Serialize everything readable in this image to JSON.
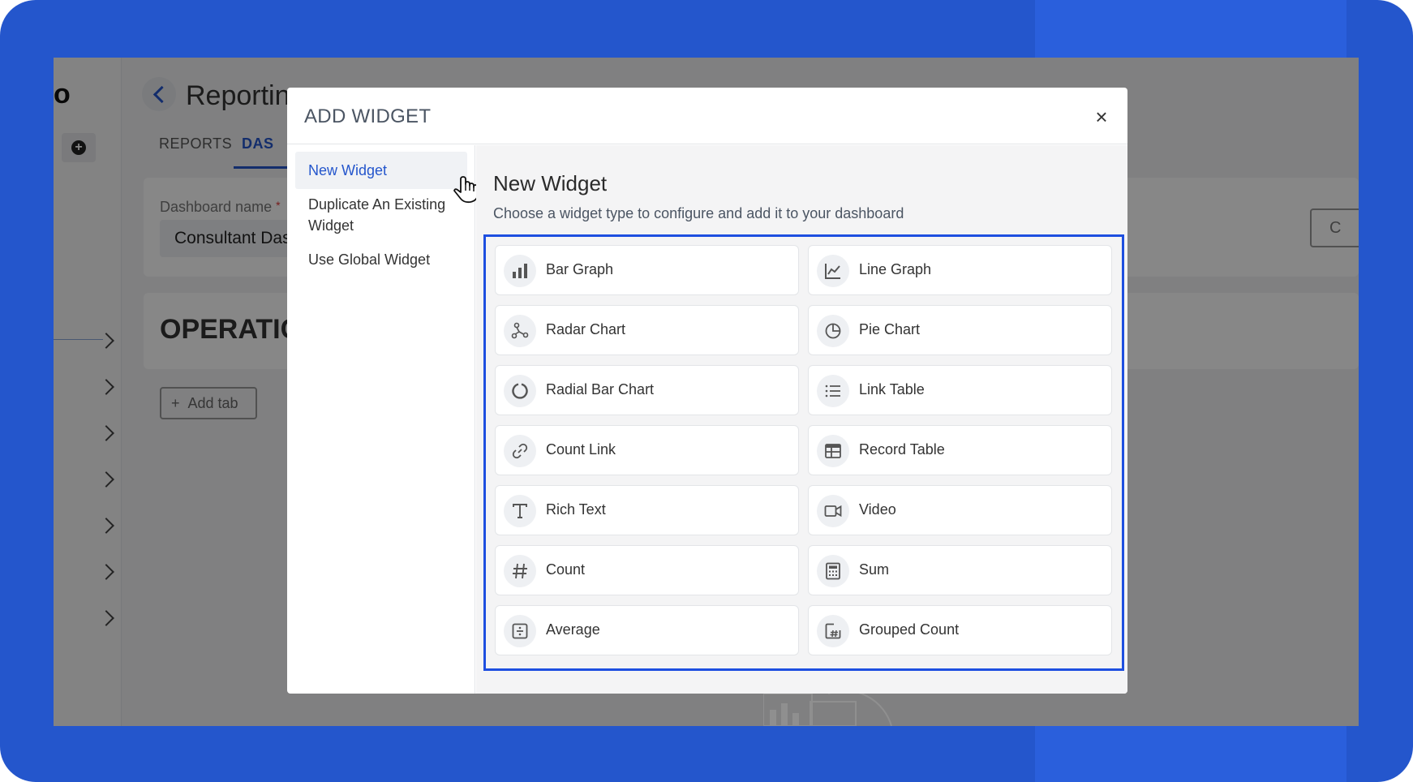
{
  "app": {
    "logo": "o",
    "page_title": "Reportin",
    "tabs": [
      "REPORTS",
      "DAS"
    ],
    "dashboard_label": "Dashboard name",
    "dashboard_required": "*",
    "dashboard_value": "Consultant Das",
    "section_title": "OPERATIC",
    "add_tab_label": "Add tab",
    "refresh_glyph": "C"
  },
  "modal": {
    "title": "ADD WIDGET",
    "close_glyph": "×",
    "nav": {
      "new_widget": "New Widget",
      "duplicate": "Duplicate An Existing Widget",
      "global": "Use Global Widget"
    },
    "content_title": "New Widget",
    "content_subtitle": "Choose a widget type to configure and add it to your dashboard",
    "widgets": [
      {
        "label": "Bar Graph",
        "icon": "bar-graph-icon"
      },
      {
        "label": "Line Graph",
        "icon": "line-graph-icon"
      },
      {
        "label": "Radar Chart",
        "icon": "radar-chart-icon"
      },
      {
        "label": "Pie Chart",
        "icon": "pie-chart-icon"
      },
      {
        "label": "Radial Bar Chart",
        "icon": "radial-bar-icon"
      },
      {
        "label": "Link Table",
        "icon": "list-icon"
      },
      {
        "label": "Count Link",
        "icon": "link-icon"
      },
      {
        "label": "Record Table",
        "icon": "table-icon"
      },
      {
        "label": "Rich Text",
        "icon": "text-icon"
      },
      {
        "label": "Video",
        "icon": "video-icon"
      },
      {
        "label": "Count",
        "icon": "hash-icon"
      },
      {
        "label": "Sum",
        "icon": "calculator-icon"
      },
      {
        "label": "Average",
        "icon": "average-icon"
      },
      {
        "label": "Grouped Count",
        "icon": "grouped-count-icon"
      }
    ]
  },
  "colors": {
    "frame": "#2456cc",
    "accent": "#1e4fe0",
    "text": "#333333"
  }
}
